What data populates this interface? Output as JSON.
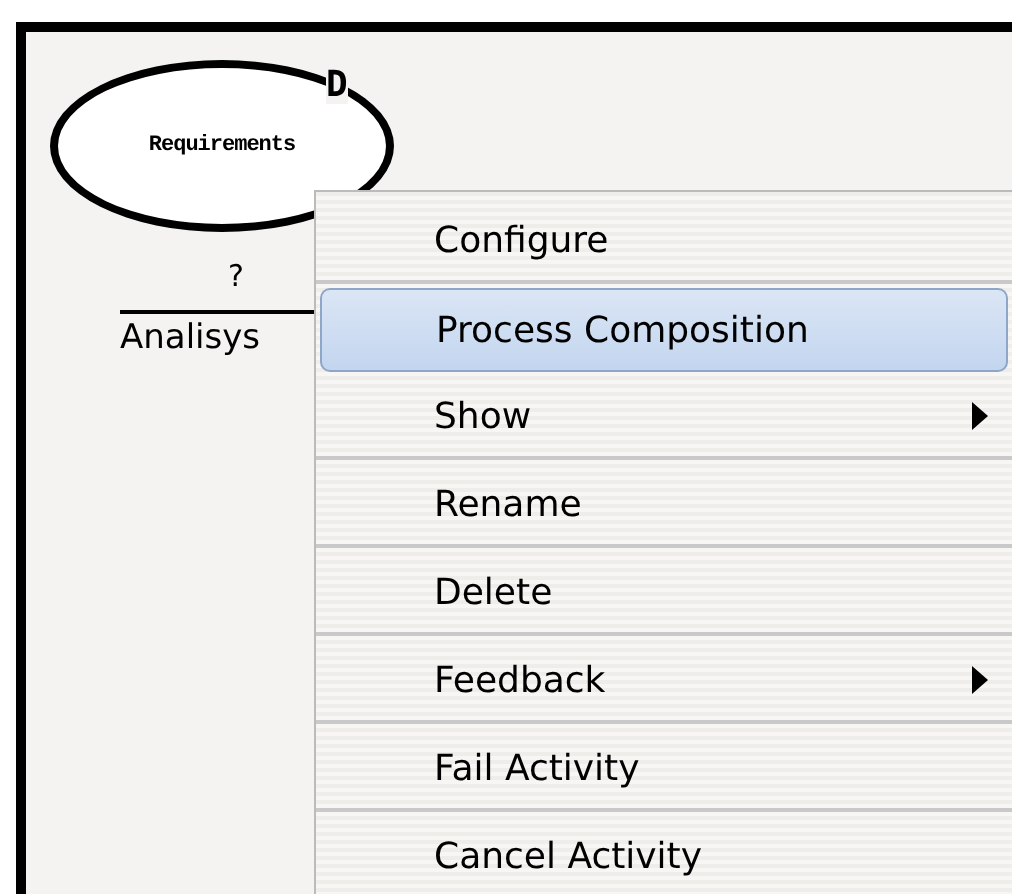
{
  "diagram": {
    "activity": {
      "name": "Requirements",
      "badge": "D",
      "status": "?",
      "label": "Analisys"
    }
  },
  "context_menu": {
    "items": [
      {
        "label": "Configure",
        "selected": false,
        "submenu": false
      },
      {
        "label": "Process Composition",
        "selected": true,
        "submenu": false
      },
      {
        "label": "Show",
        "selected": false,
        "submenu": true
      },
      {
        "label": "Rename",
        "selected": false,
        "submenu": false
      },
      {
        "label": "Delete",
        "selected": false,
        "submenu": false
      },
      {
        "label": "Feedback",
        "selected": false,
        "submenu": true
      },
      {
        "label": "Fail Activity",
        "selected": false,
        "submenu": false
      },
      {
        "label": "Cancel Activity",
        "selected": false,
        "submenu": false
      }
    ]
  }
}
